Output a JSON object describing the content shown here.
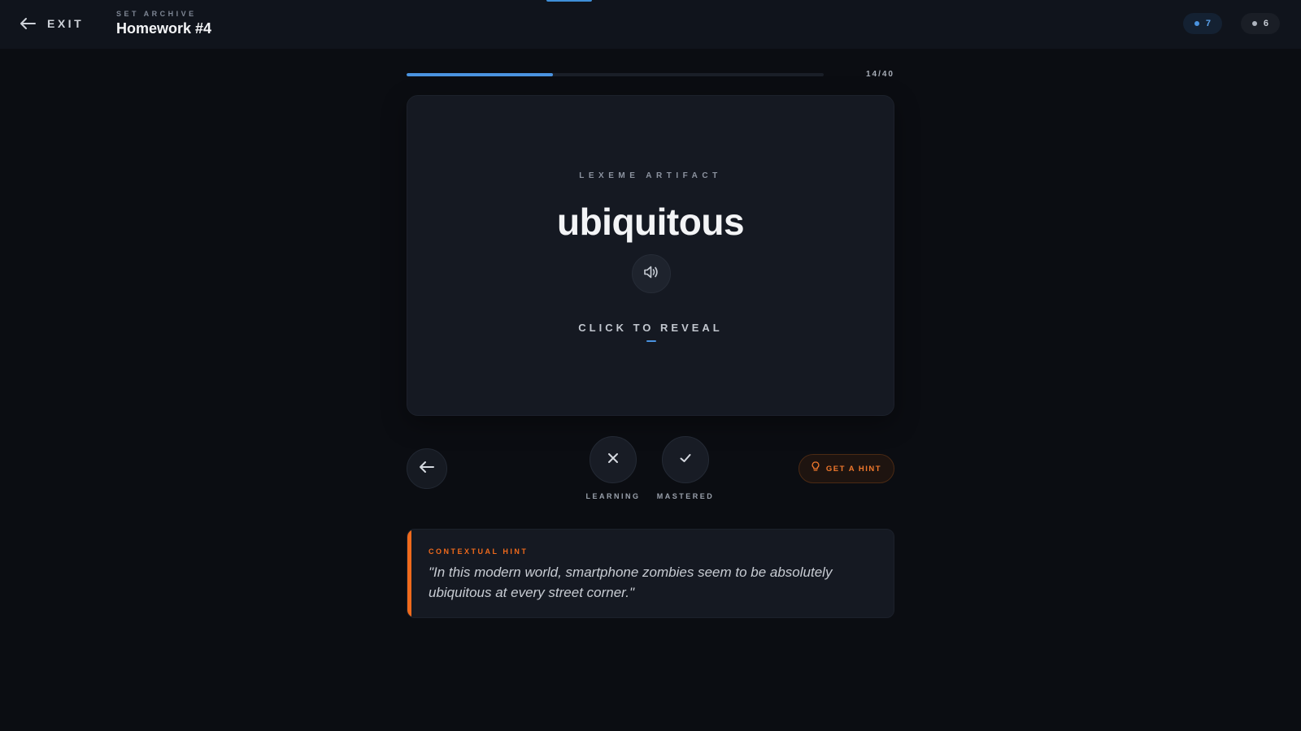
{
  "header": {
    "exit_label": "EXIT",
    "set_eyebrow": "SET ARCHIVE",
    "set_title": "Homework #4",
    "learning_count": "7",
    "mastered_count": "6"
  },
  "progress": {
    "current": 14,
    "total": 40,
    "label": "14/40",
    "fraction": 0.35
  },
  "card": {
    "eyebrow": "LEXEME ARTIFACT",
    "term": "ubiquitous",
    "reveal_label": "CLICK TO REVEAL"
  },
  "actions": {
    "learning_label": "LEARNING",
    "mastered_label": "MASTERED",
    "hint_label": "GET A HINT"
  },
  "hint": {
    "eyebrow": "CONTEXTUAL HINT",
    "text": "\"In this modern world, smartphone zombies seem to be absolutely ubiquitous at every street corner.\""
  },
  "icons": {
    "exit": "arrow-left-icon",
    "audio": "speaker-icon",
    "back": "arrow-left-icon",
    "learning": "close-icon",
    "mastered": "check-icon",
    "hint": "lightbulb-icon"
  },
  "colors": {
    "background": "#0b0d12",
    "accent_blue": "#4a93e0",
    "accent_orange": "#f06a1c",
    "card": "#151922"
  }
}
